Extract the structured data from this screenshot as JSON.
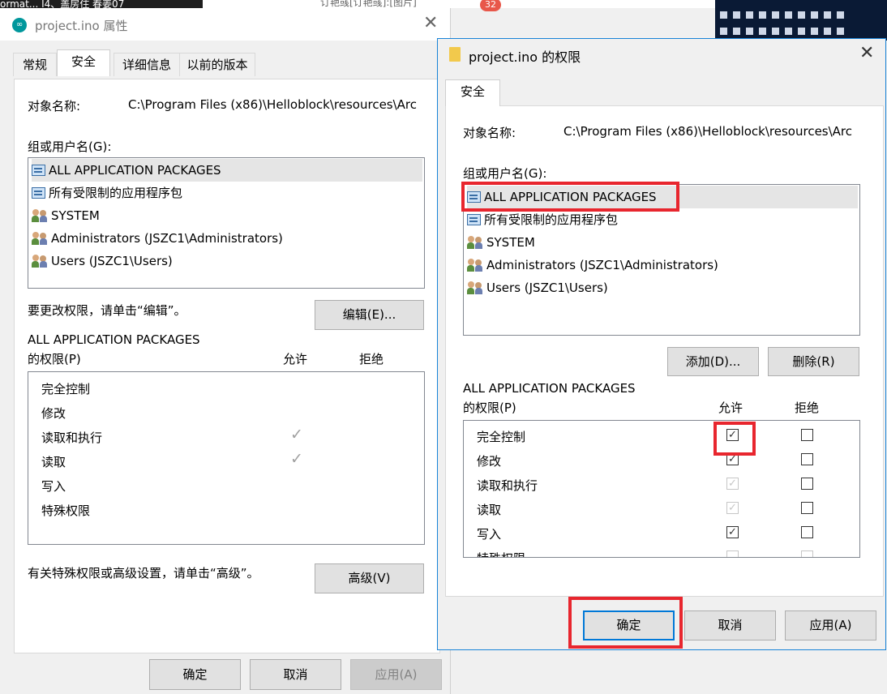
{
  "background": {
    "left_text": "ormat...   I4、盖房住   春姜07",
    "mid_text": "订艳彧[订艳彧]:[图片]",
    "badge": "32"
  },
  "left_window": {
    "title": "project.ino 属性",
    "close": "✕",
    "app_icon": "arduino-icon",
    "tabs": [
      "常规",
      "安全",
      "详细信息",
      "以前的版本"
    ],
    "object_name_label": "对象名称:",
    "object_name_value": "C:\\Program Files (x86)\\Helloblock\\resources\\Arc",
    "group_label": "组或用户名(G):",
    "users": [
      {
        "icon": "package-icon",
        "name": "ALL APPLICATION PACKAGES"
      },
      {
        "icon": "package-icon",
        "name": "所有受限制的应用程序包"
      },
      {
        "icon": "users-icon",
        "name": "SYSTEM"
      },
      {
        "icon": "users-icon",
        "name": "Administrators (JSZC1\\Administrators)"
      },
      {
        "icon": "users-icon",
        "name": "Users (JSZC1\\Users)"
      }
    ],
    "change_hint": "要更改权限，请单击“编辑”。",
    "edit_button": "编辑(E)...",
    "perm_title_line1": "ALL APPLICATION PACKAGES",
    "perm_title_line2": "的权限(P)",
    "allow_col": "允许",
    "deny_col": "拒绝",
    "permissions": [
      {
        "name": "完全控制",
        "allow": false
      },
      {
        "name": "修改",
        "allow": false
      },
      {
        "name": "读取和执行",
        "allow": true
      },
      {
        "name": "读取",
        "allow": true
      },
      {
        "name": "写入",
        "allow": false
      },
      {
        "name": "特殊权限",
        "allow": false
      }
    ],
    "check_glyph": "✓",
    "advanced_hint": "有关特殊权限或高级设置，请单击“高级”。",
    "advanced_button": "高级(V)",
    "ok": "确定",
    "cancel": "取消",
    "apply": "应用(A)"
  },
  "right_window": {
    "title": "project.ino 的权限",
    "close": "✕",
    "tab": "安全",
    "object_name_label": "对象名称:",
    "object_name_value": "C:\\Program Files (x86)\\Helloblock\\resources\\Arc",
    "group_label": "组或用户名(G):",
    "users": [
      {
        "icon": "package-icon",
        "name": "ALL APPLICATION PACKAGES"
      },
      {
        "icon": "package-icon",
        "name": "所有受限制的应用程序包"
      },
      {
        "icon": "users-icon",
        "name": "SYSTEM"
      },
      {
        "icon": "users-icon",
        "name": "Administrators (JSZC1\\Administrators)"
      },
      {
        "icon": "users-icon",
        "name": "Users (JSZC1\\Users)"
      }
    ],
    "add_button": "添加(D)...",
    "remove_button": "删除(R)",
    "perm_title_line1": "ALL APPLICATION PACKAGES",
    "perm_title_line2": "的权限(P)",
    "allow_col": "允许",
    "deny_col": "拒绝",
    "permissions": [
      {
        "name": "完全控制",
        "allow": true,
        "allow_enabled": true,
        "deny": false
      },
      {
        "name": "修改",
        "allow": true,
        "allow_enabled": true,
        "deny": false
      },
      {
        "name": "读取和执行",
        "allow": true,
        "allow_enabled": false,
        "deny": false
      },
      {
        "name": "读取",
        "allow": true,
        "allow_enabled": false,
        "deny": false
      },
      {
        "name": "写入",
        "allow": true,
        "allow_enabled": true,
        "deny": false
      },
      {
        "name": "特殊权限",
        "allow": false,
        "allow_enabled": false,
        "deny": false
      }
    ],
    "check_glyph": "✓",
    "scroll_up": "∧",
    "scroll_down": "∨",
    "ok": "确定",
    "cancel": "取消",
    "apply": "应用(A)",
    "highlight_color": "#e8262e"
  }
}
